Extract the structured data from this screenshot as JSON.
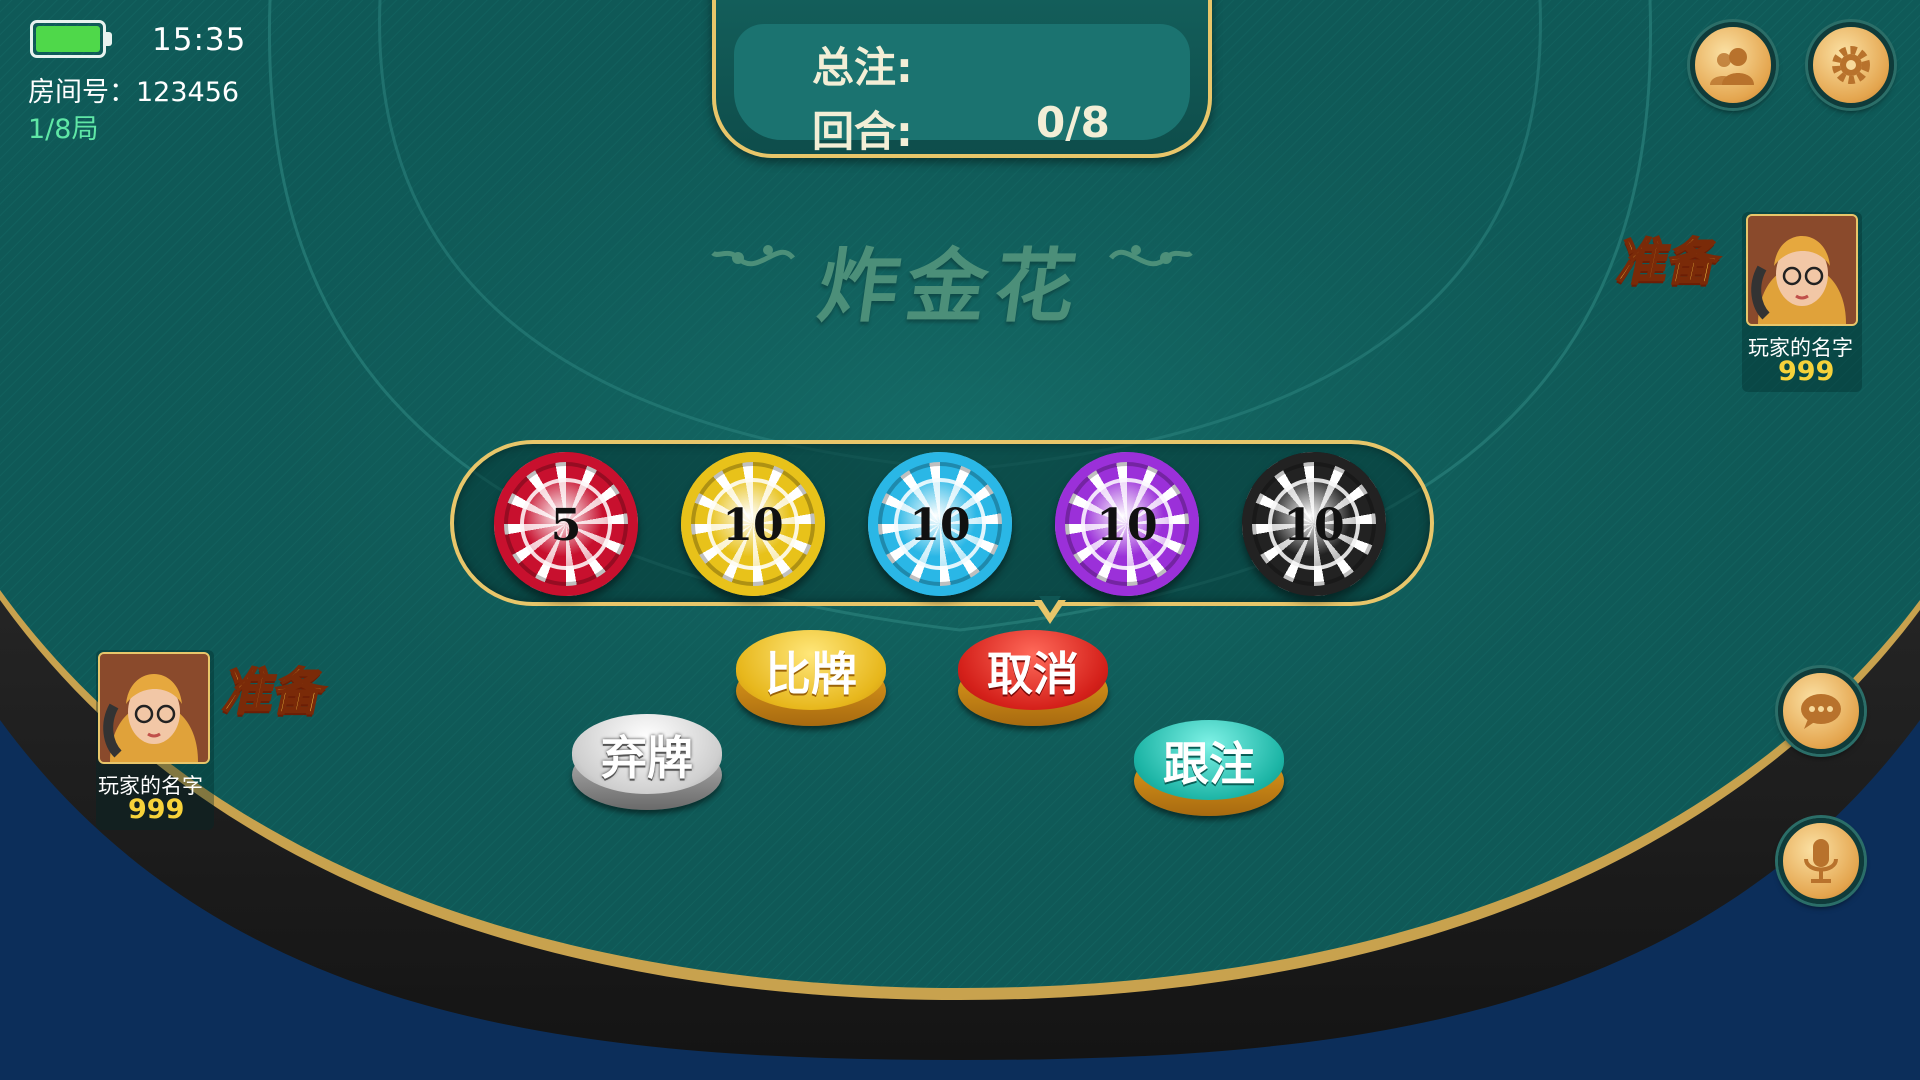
{
  "status": {
    "battery_level": 1.0,
    "time": "15:35"
  },
  "room": {
    "number_text": "房间号：123456",
    "round_text": "1/8局"
  },
  "info_panel": {
    "total_bet_label": "总注:",
    "round_label": "回合:",
    "round_value": "0/8"
  },
  "game_title": "炸金花",
  "top_buttons": {
    "friends_icon": "friends-icon",
    "settings_icon": "gear-icon"
  },
  "side_buttons": {
    "chat_icon": "chat-bubble-icon",
    "voice_icon": "microphone-icon"
  },
  "players": [
    {
      "name": "玩家的名字",
      "score": "999",
      "status": "准备"
    },
    {
      "name": "玩家的名字",
      "score": "999",
      "status": "准备"
    }
  ],
  "chips": [
    {
      "value": "5",
      "color": "#c8102e"
    },
    {
      "value": "10",
      "color": "#e8c21a"
    },
    {
      "value": "10",
      "color": "#2ab7e6"
    },
    {
      "value": "10",
      "color": "#9b30d9"
    },
    {
      "value": "10",
      "color": "#222222"
    }
  ],
  "actions": {
    "compare": "比牌",
    "cancel": "取消",
    "fold": "弃牌",
    "follow": "跟注"
  },
  "colors": {
    "felt": "#0f5a58",
    "gold": "#e8c66a",
    "rail": "#1c1c1c"
  }
}
